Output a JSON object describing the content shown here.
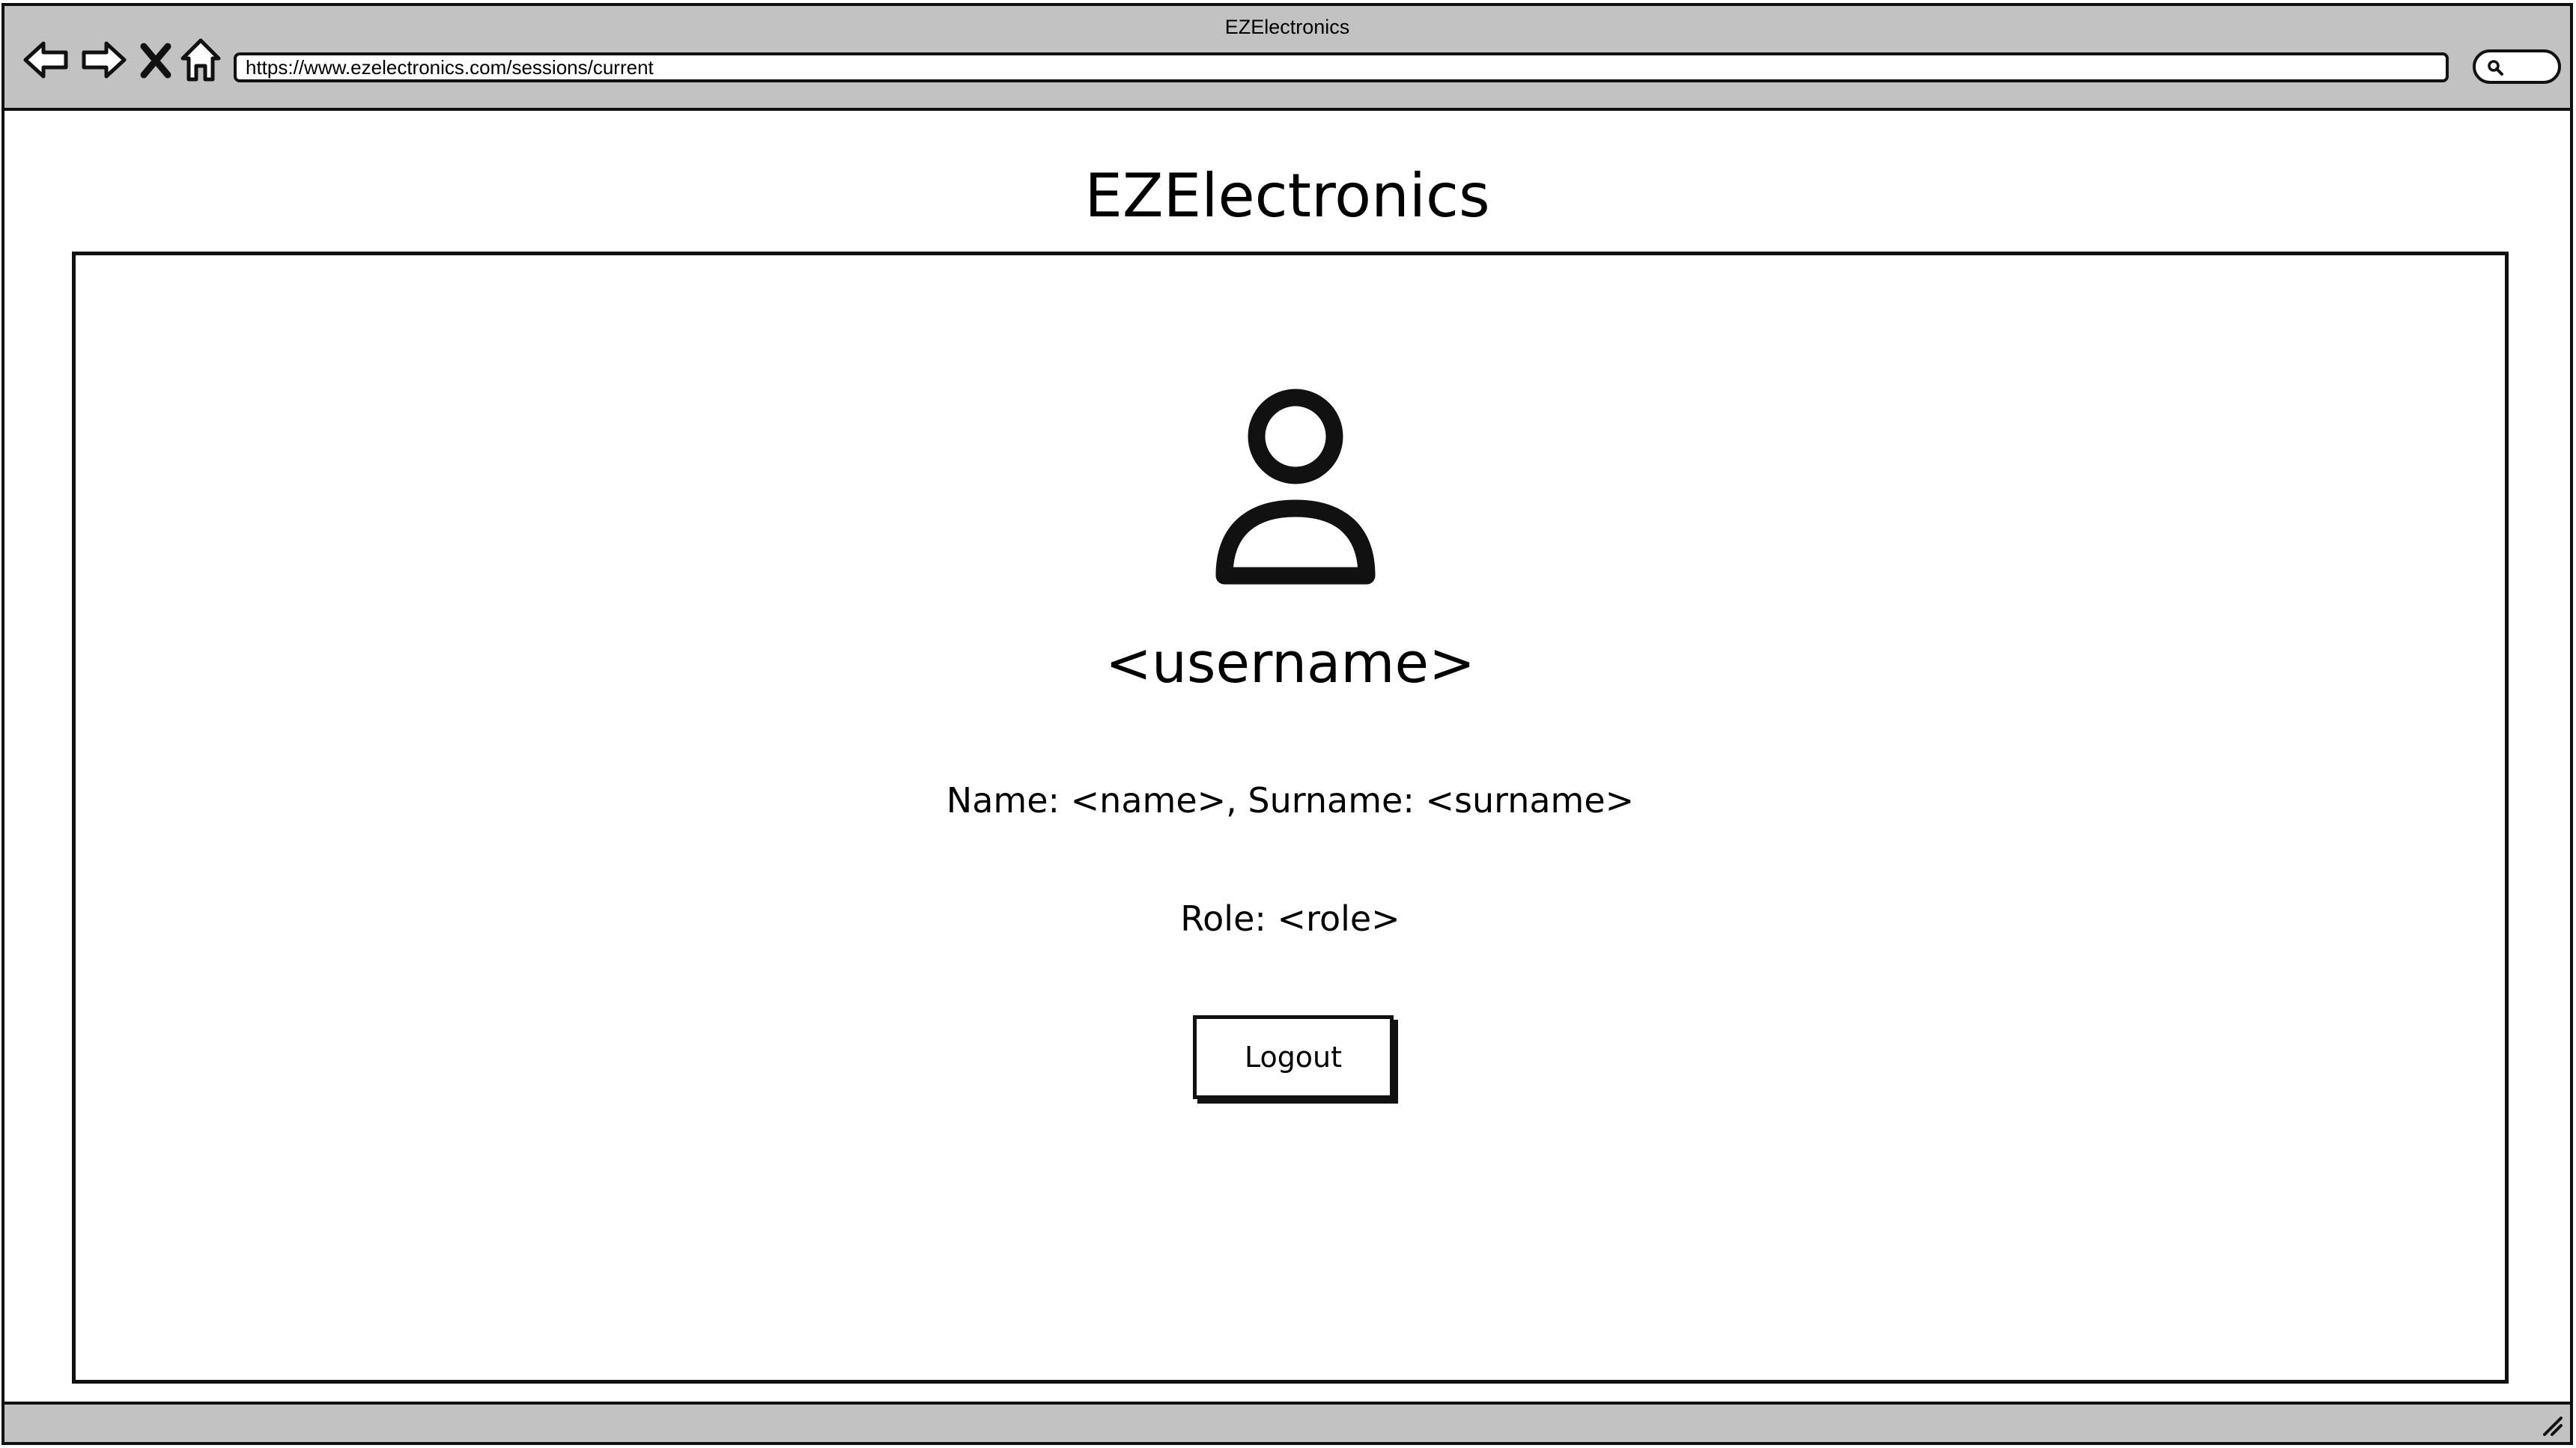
{
  "window": {
    "title": "EZElectronics"
  },
  "toolbar": {
    "back_icon": "back-arrow-icon",
    "forward_icon": "forward-arrow-icon",
    "stop_icon": "close-icon",
    "home_icon": "home-icon",
    "search_icon": "search-icon"
  },
  "address_bar": {
    "url": "https://www.ezelectronics.com/sessions/current"
  },
  "page": {
    "site_title": "EZElectronics"
  },
  "profile": {
    "avatar_icon": "user-icon",
    "username": "<username>",
    "name_line": "Name: <name>, Surname: <surname>",
    "role_line": "Role: <role>",
    "logout_label": "Logout"
  },
  "colors": {
    "chrome": "#c2c2c2",
    "ink": "#111111",
    "background": "#ffffff"
  }
}
